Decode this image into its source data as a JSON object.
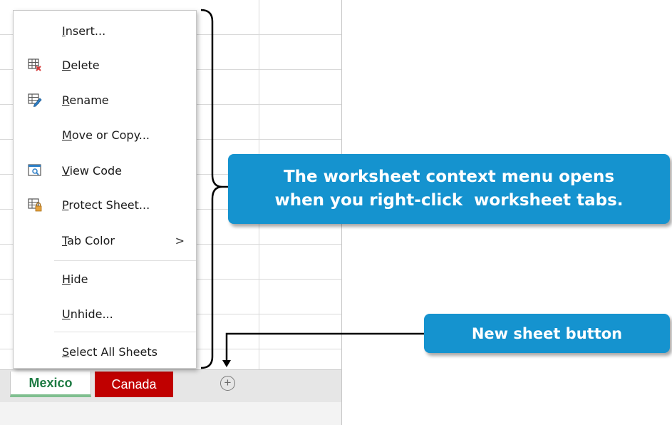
{
  "menu": {
    "items": [
      {
        "pre": "",
        "key": "I",
        "rest": "nsert...",
        "icon": "none"
      },
      {
        "pre": "",
        "key": "D",
        "rest": "elete",
        "icon": "delete-sheet-icon"
      },
      {
        "pre": "",
        "key": "R",
        "rest": "ename",
        "icon": "rename-sheet-icon"
      },
      {
        "pre": "",
        "key": "M",
        "rest": "ove or Copy...",
        "icon": "none"
      },
      {
        "pre": "",
        "key": "V",
        "rest": "iew Code",
        "icon": "view-code-icon"
      },
      {
        "pre": "",
        "key": "P",
        "rest": "rotect Sheet...",
        "icon": "protect-sheet-icon"
      },
      {
        "pre": "",
        "key": "T",
        "rest": "ab Color",
        "icon": "none",
        "submenu_arrow": ">"
      },
      {
        "pre": "",
        "key": "H",
        "rest": "ide",
        "icon": "none"
      },
      {
        "pre": "",
        "key": "U",
        "rest": "nhide...",
        "icon": "none"
      },
      {
        "pre": "",
        "key": "S",
        "rest": "elect All Sheets",
        "icon": "none"
      }
    ]
  },
  "tabs": [
    {
      "label": "Mexico",
      "color": "#1e7b43",
      "active": true
    },
    {
      "label": "Canada",
      "color": "#c00000",
      "active": false
    }
  ],
  "new_sheet_button": {
    "glyph": "+"
  },
  "callouts": {
    "context_menu": {
      "line1": "The worksheet context menu opens",
      "line2": "when you right-click  worksheet tabs."
    },
    "new_sheet": {
      "text": "New sheet button"
    }
  },
  "colors": {
    "callout": "#1593cf",
    "canada_tab": "#c00000",
    "mexico_text": "#1e7b43"
  }
}
